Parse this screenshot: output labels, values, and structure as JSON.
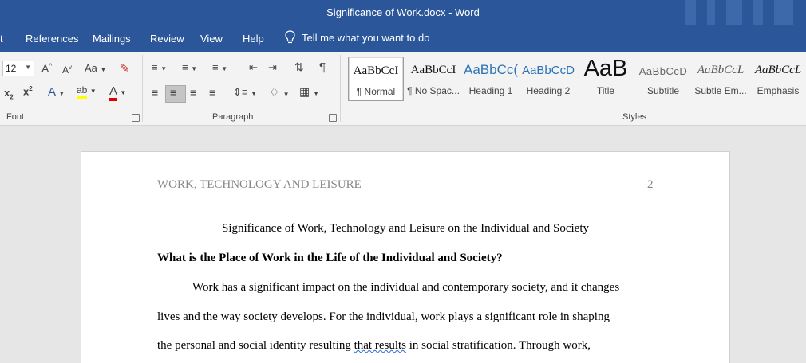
{
  "window": {
    "title": "Significance of Work.docx  -  Word"
  },
  "tabs": [
    {
      "label": "t"
    },
    {
      "label": "References"
    },
    {
      "label": "Mailings"
    },
    {
      "label": "Review"
    },
    {
      "label": "View"
    },
    {
      "label": "Help"
    }
  ],
  "tell_me": {
    "placeholder": "Tell me what you want to do",
    "icon": "lightbulb-icon"
  },
  "ribbon": {
    "font": {
      "size": "12",
      "group_label": "Font"
    },
    "paragraph": {
      "group_label": "Paragraph"
    },
    "styles_label": "Styles",
    "styles": [
      {
        "sample": "AaBbCcI",
        "name": "¶ Normal"
      },
      {
        "sample": "AaBbCcI",
        "name": "¶ No Spac..."
      },
      {
        "sample": "AaBbCc(",
        "name": "Heading 1"
      },
      {
        "sample": "AaBbCcD",
        "name": "Heading 2"
      },
      {
        "sample": "AaB",
        "name": "Title"
      },
      {
        "sample": "AaBbCcD",
        "name": "Subtitle"
      },
      {
        "sample": "AaBbCcL",
        "name": "Subtle Em..."
      },
      {
        "sample": "AaBbCcL",
        "name": "Emphasis"
      }
    ]
  },
  "colors": {
    "title_bar": "#2b579a",
    "highlight": "#ffff00",
    "font_color": "#e00000"
  },
  "document": {
    "running_head": "WORK, TECHNOLOGY AND LEISURE",
    "page_number": "2",
    "title": "Significance of Work, Technology and Leisure on the Individual and Society",
    "heading": "What is the Place of Work in the Life of the Individual and Society?",
    "line1": "Work has a significant impact on the individual and contemporary society, and it changes",
    "line2": "lives and the way society develops. For the individual, work plays a significant role in shaping",
    "line3_a": "the personal and social identity resulting ",
    "line3_squiggle": "that results",
    "line3_b": " in social stratification. Through work,"
  }
}
